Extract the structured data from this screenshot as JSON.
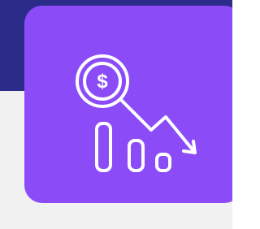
{
  "icon": {
    "name": "falling-cost-chart-icon",
    "stroke_color": "#ffffff"
  },
  "colors": {
    "background_top": "#2b2c8a",
    "background_bottom": "#f1f1f1",
    "tile": "#8b4cf8"
  }
}
